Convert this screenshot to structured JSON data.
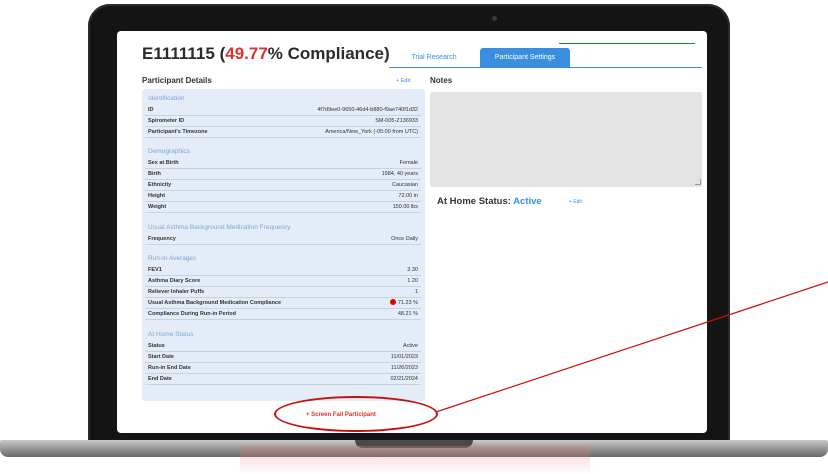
{
  "header": {
    "participant_id": "E1111115",
    "open_paren": " (",
    "compliance_value": "49.77",
    "compliance_suffix": "% Compliance)"
  },
  "tabs": [
    {
      "label": "Trial Research",
      "active": false
    },
    {
      "label": "Participant Settings",
      "active": true
    }
  ],
  "details": {
    "title": "Participant Details",
    "edit_label": "+ Edit",
    "groups": {
      "identification": {
        "label": "Identification",
        "rows": [
          {
            "k": "ID",
            "v": "4f7d9ee0-9650-46d4-b880-f9ae740f1d32"
          },
          {
            "k": "Spirometer ID",
            "v": "SM-005-Z136933"
          },
          {
            "k": "Participant's Timezone",
            "v": "America/New_York (-05:00 from UTC)"
          }
        ]
      },
      "demographics": {
        "label": "Demographics",
        "rows": [
          {
            "k": "Sex at Birth",
            "v": "Female"
          },
          {
            "k": "Birth",
            "v": "1984, 40 years"
          },
          {
            "k": "Ethnicity",
            "v": "Caucasian"
          },
          {
            "k": "Height",
            "v": "72.00 in"
          },
          {
            "k": "Weight",
            "v": "150.00 lbs"
          }
        ]
      },
      "medication": {
        "label": "Usual Asthma Background Medication Frequency",
        "rows": [
          {
            "k": "Frequency",
            "v": "Once Daily"
          }
        ]
      },
      "runin": {
        "label": "Run-In Averages",
        "rows": [
          {
            "k": "FEV1",
            "v": "3.30"
          },
          {
            "k": "Asthma Diary Score",
            "v": "1.20"
          },
          {
            "k": "Reliever Inhaler Puffs",
            "v": "1"
          },
          {
            "k": "Usual Asthma Background Medication Compliance",
            "v": "71.23 %"
          },
          {
            "k": "Compliance During Run-in Period",
            "v": "48.21 %"
          }
        ]
      },
      "home_status": {
        "label": "At Home Status",
        "rows": [
          {
            "k": "Status",
            "v": "Active"
          },
          {
            "k": "Start Date",
            "v": "11/01/2023"
          },
          {
            "k": "Run-in End Date",
            "v": "11/26/2023"
          },
          {
            "k": "End Date",
            "v": "02/21/2024"
          }
        ]
      }
    }
  },
  "notes": {
    "title": "Notes",
    "value": ""
  },
  "at_home": {
    "label": "At Home Status: ",
    "value": "Active",
    "edit_label": "+ Edit"
  },
  "screen_fail_label": "+ Screen Fail Participant",
  "colors": {
    "accent_blue": "#3a8ee0",
    "compliance_red": "#e03030",
    "panel_bg": "#e3ecf7",
    "annotation_red": "#c81010"
  },
  "icons": {
    "warning_dot": "red-dot-icon"
  }
}
